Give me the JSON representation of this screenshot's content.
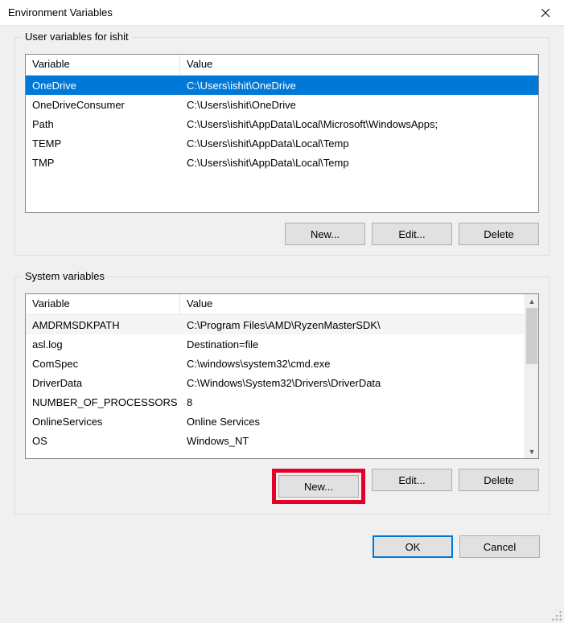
{
  "window": {
    "title": "Environment Variables"
  },
  "userGroup": {
    "legend": "User variables for ishit",
    "headers": {
      "variable": "Variable",
      "value": "Value"
    },
    "rows": [
      {
        "variable": "OneDrive",
        "value": "C:\\Users\\ishit\\OneDrive"
      },
      {
        "variable": "OneDriveConsumer",
        "value": "C:\\Users\\ishit\\OneDrive"
      },
      {
        "variable": "Path",
        "value": "C:\\Users\\ishit\\AppData\\Local\\Microsoft\\WindowsApps;"
      },
      {
        "variable": "TEMP",
        "value": "C:\\Users\\ishit\\AppData\\Local\\Temp"
      },
      {
        "variable": "TMP",
        "value": "C:\\Users\\ishit\\AppData\\Local\\Temp"
      }
    ],
    "selectedIndex": 0,
    "buttons": {
      "new": "New...",
      "edit": "Edit...",
      "delete": "Delete"
    }
  },
  "systemGroup": {
    "legend": "System variables",
    "headers": {
      "variable": "Variable",
      "value": "Value"
    },
    "rows": [
      {
        "variable": "AMDRMSDKPATH",
        "value": "C:\\Program Files\\AMD\\RyzenMasterSDK\\"
      },
      {
        "variable": "asl.log",
        "value": "Destination=file"
      },
      {
        "variable": "ComSpec",
        "value": "C:\\windows\\system32\\cmd.exe"
      },
      {
        "variable": "DriverData",
        "value": "C:\\Windows\\System32\\Drivers\\DriverData"
      },
      {
        "variable": "NUMBER_OF_PROCESSORS",
        "value": "8"
      },
      {
        "variable": "OnlineServices",
        "value": "Online Services"
      },
      {
        "variable": "OS",
        "value": "Windows_NT"
      }
    ],
    "altIndex": 0,
    "buttons": {
      "new": "New...",
      "edit": "Edit...",
      "delete": "Delete"
    }
  },
  "footer": {
    "ok": "OK",
    "cancel": "Cancel"
  }
}
